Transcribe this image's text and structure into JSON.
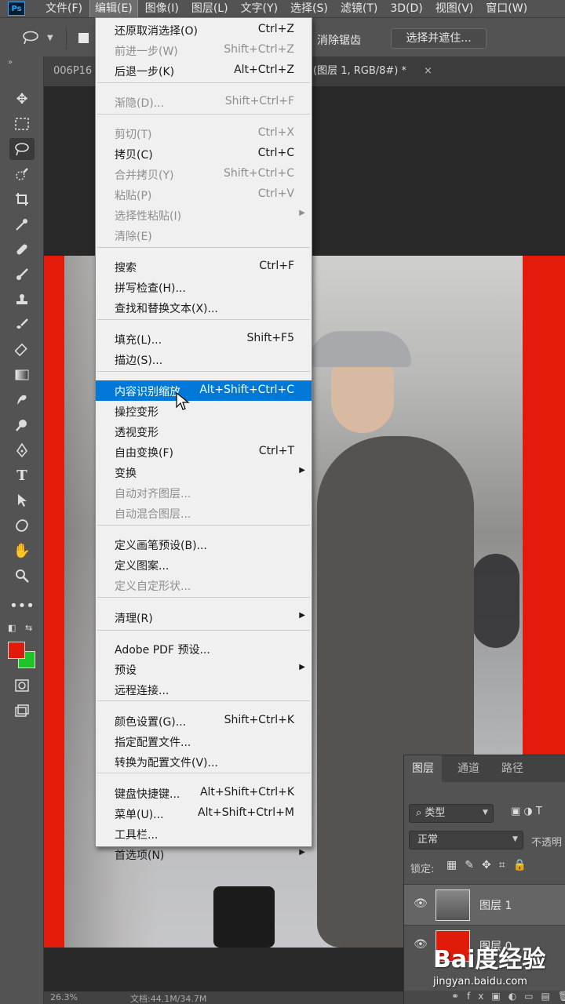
{
  "menubar": {
    "logo": "Ps",
    "items": [
      "文件(F)",
      "编辑(E)",
      "图像(I)",
      "图层(L)",
      "文字(Y)",
      "选择(S)",
      "滤镜(T)",
      "3D(D)",
      "视图(V)",
      "窗口(W)"
    ]
  },
  "options": {
    "antialias": "消除锯齿",
    "select_and_mask": "选择并遮住..."
  },
  "tabs": {
    "left": "006P16",
    "active": "(图层 1, RGB/8#) *",
    "close": "×"
  },
  "edit_menu": [
    {
      "label": "还原取消选择(O)",
      "shortcut": "Ctrl+Z",
      "state": "enabled"
    },
    {
      "label": "前进一步(W)",
      "shortcut": "Shift+Ctrl+Z",
      "state": "disabled"
    },
    {
      "label": "后退一步(K)",
      "shortcut": "Alt+Ctrl+Z",
      "state": "enabled"
    },
    {
      "label": "渐隐(D)...",
      "shortcut": "Shift+Ctrl+F",
      "state": "disabled"
    },
    {
      "label": "剪切(T)",
      "shortcut": "Ctrl+X",
      "state": "disabled"
    },
    {
      "label": "拷贝(C)",
      "shortcut": "Ctrl+C",
      "state": "enabled"
    },
    {
      "label": "合并拷贝(Y)",
      "shortcut": "Shift+Ctrl+C",
      "state": "disabled"
    },
    {
      "label": "粘贴(P)",
      "shortcut": "Ctrl+V",
      "state": "disabled"
    },
    {
      "label": "选择性粘贴(I)",
      "shortcut": "",
      "state": "disabled",
      "submenu": true
    },
    {
      "label": "清除(E)",
      "shortcut": "",
      "state": "disabled"
    },
    {
      "label": "搜索",
      "shortcut": "Ctrl+F",
      "state": "enabled"
    },
    {
      "label": "拼写检查(H)...",
      "shortcut": "",
      "state": "enabled"
    },
    {
      "label": "查找和替换文本(X)...",
      "shortcut": "",
      "state": "enabled"
    },
    {
      "label": "填充(L)...",
      "shortcut": "Shift+F5",
      "state": "enabled"
    },
    {
      "label": "描边(S)...",
      "shortcut": "",
      "state": "enabled"
    },
    {
      "label": "内容识别缩放",
      "shortcut": "Alt+Shift+Ctrl+C",
      "state": "highlighted"
    },
    {
      "label": "操控变形",
      "shortcut": "",
      "state": "enabled"
    },
    {
      "label": "透视变形",
      "shortcut": "",
      "state": "enabled"
    },
    {
      "label": "自由变换(F)",
      "shortcut": "Ctrl+T",
      "state": "enabled"
    },
    {
      "label": "变换",
      "shortcut": "",
      "state": "enabled",
      "submenu": true
    },
    {
      "label": "自动对齐图层...",
      "shortcut": "",
      "state": "disabled"
    },
    {
      "label": "自动混合图层...",
      "shortcut": "",
      "state": "disabled"
    },
    {
      "label": "定义画笔预设(B)...",
      "shortcut": "",
      "state": "enabled"
    },
    {
      "label": "定义图案...",
      "shortcut": "",
      "state": "enabled"
    },
    {
      "label": "定义自定形状...",
      "shortcut": "",
      "state": "disabled"
    },
    {
      "label": "清理(R)",
      "shortcut": "",
      "state": "enabled",
      "submenu": true
    },
    {
      "label": "Adobe PDF 预设...",
      "shortcut": "",
      "state": "enabled"
    },
    {
      "label": "预设",
      "shortcut": "",
      "state": "enabled",
      "submenu": true
    },
    {
      "label": "远程连接...",
      "shortcut": "",
      "state": "enabled"
    },
    {
      "label": "颜色设置(G)...",
      "shortcut": "Shift+Ctrl+K",
      "state": "enabled"
    },
    {
      "label": "指定配置文件...",
      "shortcut": "",
      "state": "enabled"
    },
    {
      "label": "转换为配置文件(V)...",
      "shortcut": "",
      "state": "enabled"
    },
    {
      "label": "键盘快捷键...",
      "shortcut": "Alt+Shift+Ctrl+K",
      "state": "enabled"
    },
    {
      "label": "菜单(U)...",
      "shortcut": "Alt+Shift+Ctrl+M",
      "state": "enabled"
    },
    {
      "label": "工具栏...",
      "shortcut": "",
      "state": "enabled"
    },
    {
      "label": "首选项(N)",
      "shortcut": "",
      "state": "enabled",
      "submenu": true
    }
  ],
  "tools": [
    "move-icon",
    "marquee-icon",
    "lasso-icon",
    "quick-select-icon",
    "crop-icon",
    "eyedropper-icon",
    "healing-icon",
    "brush-icon",
    "stamp-icon",
    "history-brush-icon",
    "eraser-icon",
    "gradient-icon",
    "smudge-icon",
    "dodge-icon",
    "pen-icon",
    "type-icon",
    "path-select-icon",
    "shape-icon",
    "hand-icon",
    "zoom-icon",
    "more-icon"
  ],
  "colors": {
    "foreground": "#e01b0a",
    "background": "#1ec42a",
    "highlight": "#0078d7"
  },
  "layers_panel": {
    "tabs": [
      "图层",
      "通道",
      "路径"
    ],
    "filter": "类型",
    "blend_mode": "正常",
    "opacity_label": "不透明",
    "lock_label": "锁定:",
    "layers": [
      {
        "name": "图层 1",
        "selected": true
      },
      {
        "name": "图层 0",
        "selected": false
      }
    ]
  },
  "status": {
    "zoom": "26.3%",
    "doc": "文档:44.1M/34.7M"
  },
  "watermark": {
    "logo": "Bai度经验",
    "url": "jingyan.baidu.com"
  }
}
